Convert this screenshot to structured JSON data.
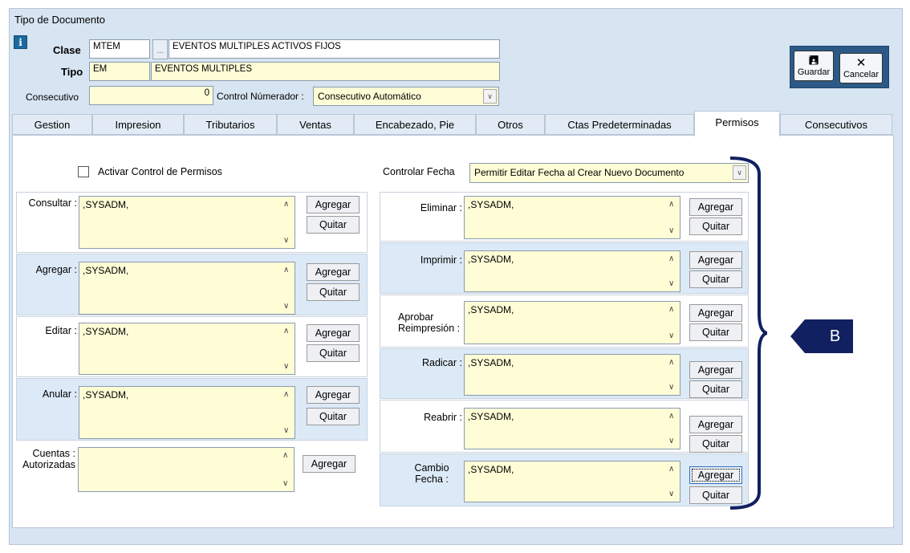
{
  "window": {
    "title": "Tipo de Documento"
  },
  "header": {
    "clase_label": "Clase",
    "clase_code": "MTEM",
    "clase_desc": "EVENTOS MULTIPLES ACTIVOS FIJOS",
    "tipo_label": "Tipo",
    "tipo_code": "EM",
    "tipo_desc": "EVENTOS MULTIPLES",
    "consecutivo_label": "Consecutivo",
    "consecutivo_value": "0",
    "control_label": "Control Númerador :",
    "control_value": "Consecutivo Automático",
    "dots": "..."
  },
  "toolbar": {
    "save_label": "Guardar",
    "cancel_label": "Cancelar"
  },
  "tabs": [
    "Gestion",
    "Impresion",
    "Tributarios",
    "Ventas",
    "Encabezado, Pie",
    "Otros",
    "Ctas Predeterminadas",
    "Permisos",
    "Consecutivos"
  ],
  "active_tab": "Permisos",
  "permisos": {
    "activar_label": "Activar Control de Permisos",
    "controlar_fecha_label": "Controlar Fecha",
    "controlar_fecha_value": "Permitir Editar Fecha al Crear Nuevo Documento",
    "add_label": "Agregar",
    "remove_label": "Quitar",
    "left": [
      {
        "label": "Consultar :",
        "value": ",SYSADM,"
      },
      {
        "label": "Agregar :",
        "value": ",SYSADM,"
      },
      {
        "label": "Editar :",
        "value": ",SYSADM,"
      },
      {
        "label": "Anular :",
        "value": ",SYSADM,"
      },
      {
        "label": "Cuentas : Autorizadas",
        "value": ""
      }
    ],
    "right": [
      {
        "label": "Eliminar :",
        "value": ",SYSADM,"
      },
      {
        "label": "Imprimir :",
        "value": ",SYSADM,"
      },
      {
        "label": "Aprobar Reimpresión :",
        "value": ",SYSADM,"
      },
      {
        "label": "Radicar :",
        "value": ",SYSADM,"
      },
      {
        "label": "Reabrir :",
        "value": ",SYSADM,"
      },
      {
        "label": "Cambio Fecha :",
        "value": ",SYSADM,"
      }
    ]
  },
  "annotation": {
    "callout_label": "B",
    "color": "#102060"
  }
}
